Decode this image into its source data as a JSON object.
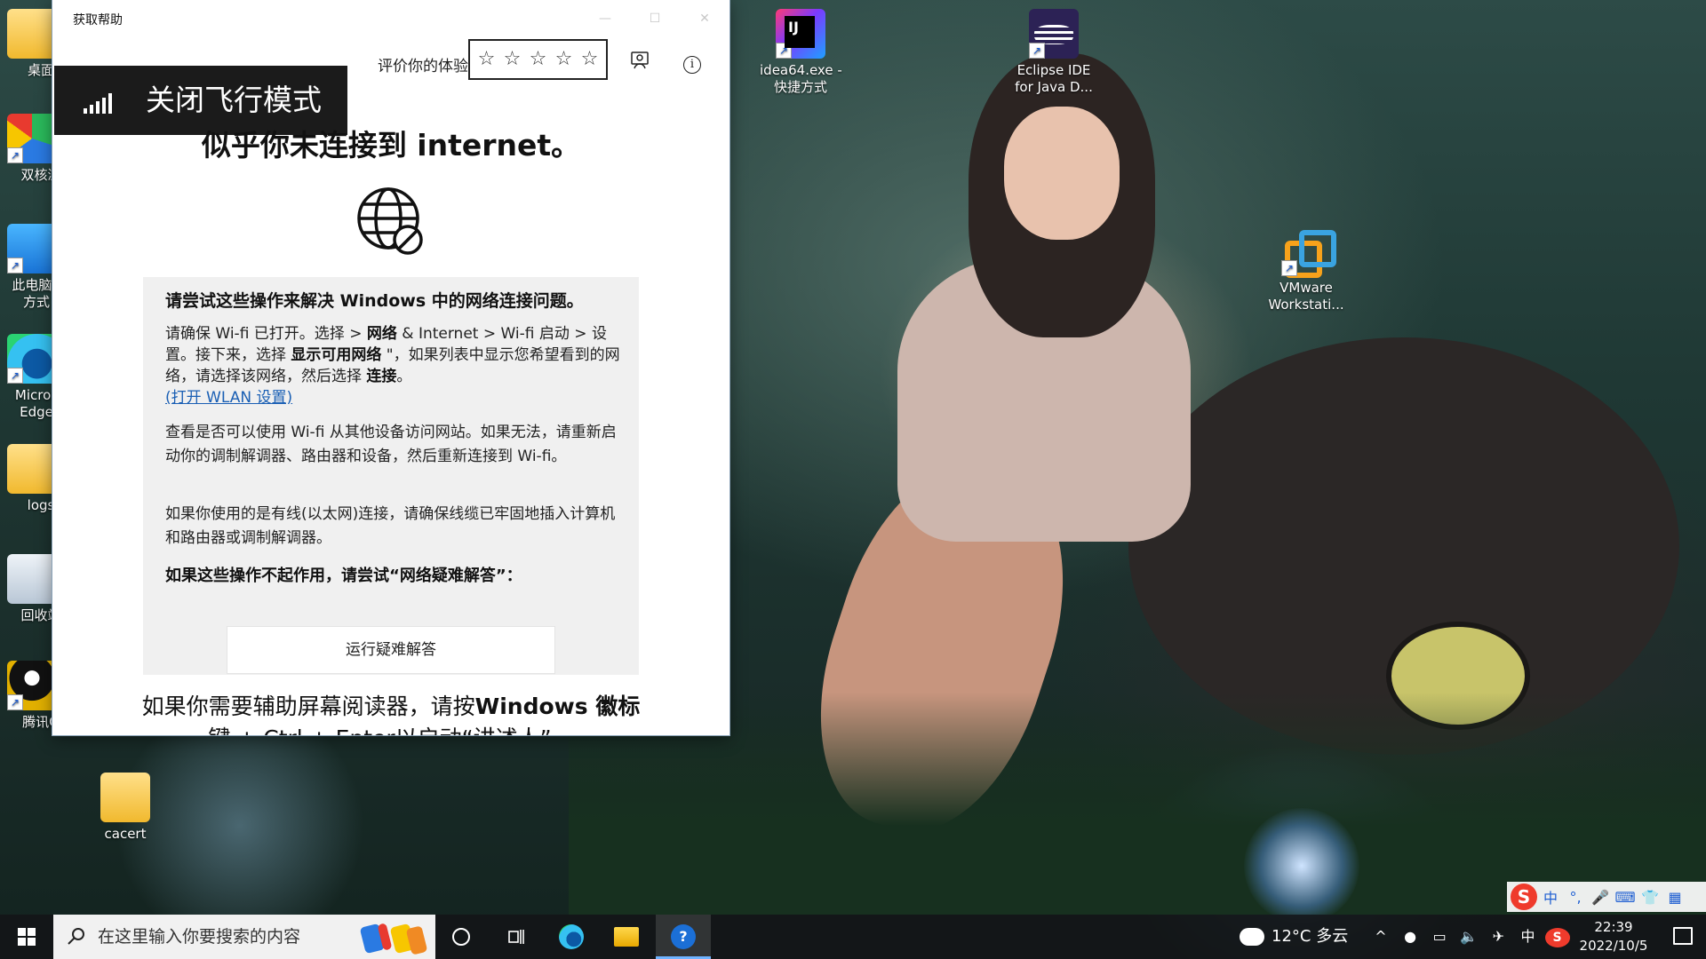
{
  "desktop": {
    "icons": [
      {
        "label": "桌面",
        "icon": "folder-icon"
      },
      {
        "label": "双核浏",
        "icon": "dual-core-browser-icon"
      },
      {
        "label": "此电脑 -\n方式",
        "icon": "this-pc-icon"
      },
      {
        "label": "Micros\nEdge",
        "icon": "edge-icon"
      },
      {
        "label": "logs",
        "icon": "folder-icon"
      },
      {
        "label": "回收站",
        "icon": "recycle-bin-icon"
      },
      {
        "label": "腾讯Q",
        "icon": "qq-icon"
      },
      {
        "label": "cacert",
        "icon": "folder-icon"
      },
      {
        "label": "idea64.exe -\n快捷方式",
        "icon": "intellij-idea-icon"
      },
      {
        "label": "Eclipse IDE\nfor Java D...",
        "icon": "eclipse-icon"
      },
      {
        "label": "VMware\nWorkstati...",
        "icon": "vmware-icon"
      }
    ]
  },
  "window": {
    "title": "获取帮助",
    "controls": [
      "—",
      "☐",
      "✕"
    ],
    "toolbar": {
      "rate_label": "评价你的体验",
      "stars": [
        "☆",
        "☆",
        "☆",
        "☆",
        "☆"
      ],
      "feedback_icon": "feedback-icon",
      "info_icon": "info-icon",
      "info_glyph": "i"
    },
    "airplane_toast": {
      "text": "关闭飞行模式",
      "icon": "signal-bars-icon"
    },
    "headline": "似乎你未连接到 internet。",
    "globe_icon": "globe-no-connection-icon",
    "panel": {
      "heading": "请尝试这些操作来解决 Windows 中的网络连接问题。",
      "para1": {
        "t1": "请确保 Wi-fi 已打开。选择 > ",
        "b1": "网络",
        "t2": " & Internet > Wi-fi 启动 > 设置。接下来，选择 ",
        "b2": "显示可用网络",
        "t3": " \"，如果列表中显示您希望看到的网络，请选择该网络，然后选择 ",
        "b3": "连接",
        "t4": "。",
        "link": "(打开 WLAN 设置)"
      },
      "para2": "查看是否可以使用 Wi-fi 从其他设备访问网站。如果无法，请重新启动你的调制解调器、路由器和设备，然后重新连接到 Wi-fi。",
      "para3": "如果你使用的是有线(以太网)连接，请确保线缆已牢固地插入计算机和路由器或调制解调器。",
      "question": "如果这些操作不起作用，请尝试“网络疑难解答”：",
      "button": "运行疑难解答"
    },
    "footnote": {
      "t1": "如果你需要辅助屏幕阅读器，请按",
      "b1": "Windows 徽标",
      "t2": "键 + Ctrl + Enter以启动“讲述人”。"
    }
  },
  "taskbar": {
    "search_placeholder": "在这里输入你要搜索的内容",
    "weather": "12°C 多云",
    "tray": {
      "chevron": "^",
      "ime": "中",
      "sogou": "S"
    },
    "clock": {
      "time": "22:39",
      "date": "2022/10/5"
    }
  },
  "ime_bar": {
    "logo": "S",
    "items": [
      "中",
      "°,",
      "🎤",
      "⌨",
      "👕",
      "▦"
    ]
  }
}
